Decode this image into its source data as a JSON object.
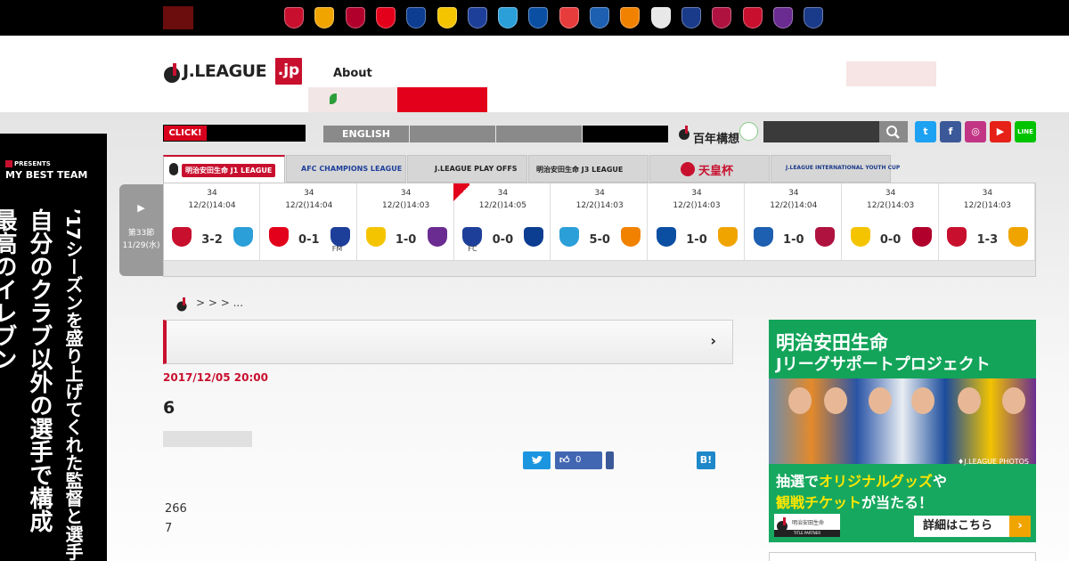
{
  "topbar": {
    "lang": [
      "",
      "",
      ""
    ],
    "club_colors": [
      "#c8102e",
      "#f0a400",
      "#b1002c",
      "#e3001a",
      "#0b3d91",
      "#f5c400",
      "#1e3f99",
      "#2b9fd8",
      "#0b4fa3",
      "#e73c3c",
      "#1d5fb0",
      "#f18200",
      "#e8e8e8",
      "#1a3a8a",
      "#b0123f",
      "#c8102e",
      "#6a2c91",
      "#1a3a8a"
    ]
  },
  "header": {
    "logo_text": "J.LEAGUE",
    "logo_jp": ".jp",
    "about": "About",
    "login": "",
    "sub_nav_label": ""
  },
  "nav": {
    "click_label": "CLICK!",
    "click_text": "",
    "english": "ENGLISH",
    "segments": [
      "",
      "",
      ""
    ],
    "hyaku_small": "",
    "hyaku_big": "百年構想",
    "search_placeholder": "",
    "social": [
      {
        "name": "twitter",
        "glyph": "t",
        "color": "#1da1f2"
      },
      {
        "name": "facebook",
        "glyph": "f",
        "color": "#3b5998"
      },
      {
        "name": "instagram",
        "glyph": "◎",
        "color": "#c13584"
      },
      {
        "name": "youtube",
        "glyph": "▶",
        "color": "#e62117"
      },
      {
        "name": "line",
        "glyph": "LINE",
        "color": "#00c300"
      }
    ]
  },
  "competitions": [
    {
      "name": "j1",
      "label": "明治安田生命 J1 LEAGUE"
    },
    {
      "name": "acl",
      "label": "AFC CHAMPIONS LEAGUE"
    },
    {
      "name": "playoffs",
      "label": "J.LEAGUE PLAY OFFS"
    },
    {
      "name": "j3",
      "label": "明治安田生命 J3 LEAGUE"
    },
    {
      "name": "emperors-cup",
      "label": "天皇杯"
    },
    {
      "name": "youth-cup",
      "label": "J.LEAGUE INTERNATIONAL YOUTH CUP"
    }
  ],
  "results": {
    "section": "第33節",
    "section_date": "11/29(水)",
    "matches": [
      {
        "sec": "34",
        "date": "12/2()14:04",
        "score": "3-2",
        "home_color": "#c8102e",
        "away_color": "#2b9fd8",
        "tag": ""
      },
      {
        "sec": "34",
        "date": "12/2()14:04",
        "score": "0-1",
        "home_color": "#e3001a",
        "away_color": "#1e3f99",
        "tag": "FM"
      },
      {
        "sec": "34",
        "date": "12/2()14:03",
        "score": "1-0",
        "home_color": "#f5c400",
        "away_color": "#6a2c91",
        "tag": ""
      },
      {
        "sec": "34",
        "date": "12/2()14:05",
        "score": "0-0",
        "home_color": "#1e3f99",
        "away_color": "#0b3d91",
        "tag": "FC"
      },
      {
        "sec": "34",
        "date": "12/2()14:03",
        "score": "5-0",
        "home_color": "#2b9fd8",
        "away_color": "#f18200",
        "tag": ""
      },
      {
        "sec": "34",
        "date": "12/2()14:03",
        "score": "1-0",
        "home_color": "#0b4fa3",
        "away_color": "#f0a400",
        "tag": ""
      },
      {
        "sec": "34",
        "date": "12/2()14:04",
        "score": "1-0",
        "home_color": "#1d5fb0",
        "away_color": "#b0123f",
        "tag": ""
      },
      {
        "sec": "34",
        "date": "12/2()14:03",
        "score": "0-0",
        "home_color": "#f5c400",
        "away_color": "#b1002c",
        "tag": ""
      },
      {
        "sec": "34",
        "date": "12/2()14:03",
        "score": "1-3",
        "home_color": "#c8102e",
        "away_color": "#f0a400",
        "tag": ""
      }
    ]
  },
  "side_banner": {
    "presents": "PRESENTS",
    "title": "MY BEST TEAM",
    "col1": "’17シーズンを盛り上げてくれた監督と選手",
    "col2": "自分のクラブ以外の選手で構成",
    "col3": "最高のイレブン"
  },
  "breadcrumb": {
    "text": "> > > ..."
  },
  "article": {
    "date": "2017/12/05 20:00",
    "title": "6",
    "like_count": "0",
    "hatena": "B!",
    "line1": "266",
    "line2": "7"
  },
  "ad": {
    "line1": "明治安田生命",
    "line2": "Jリーグサポートプロジェクト",
    "credit": "♦J.LEAGUE PHOTOS",
    "line3_a": "抽選で",
    "line3_hl": "オリジナルグッズ",
    "line3_b": "や",
    "line4_hl": "観戦チケット",
    "line4_b": "が当たる！",
    "sponsor": "明治安田生命",
    "partner": "TITLE PARTNER",
    "cta": "詳細はこちら"
  }
}
